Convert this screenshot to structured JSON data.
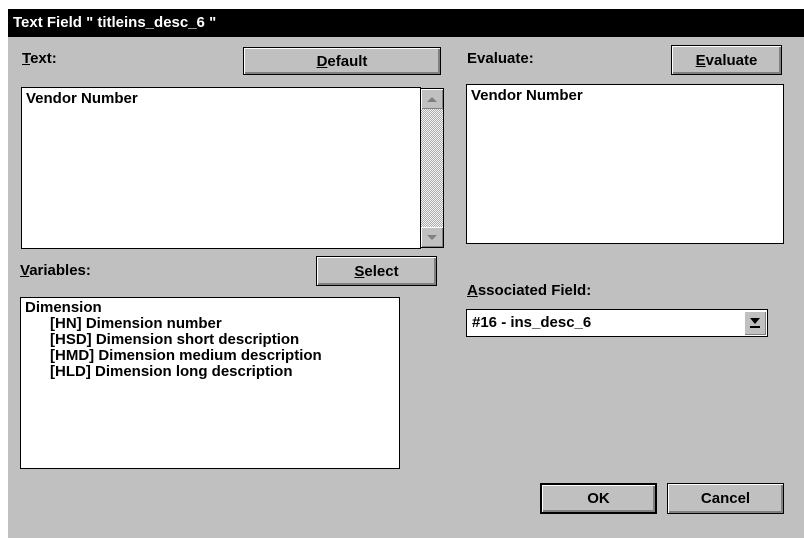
{
  "window": {
    "title": "Text Field \" titleins_desc_6 \""
  },
  "text_section": {
    "label_underlined": "T",
    "label_rest": "ext:",
    "default_btn_u": "D",
    "default_btn_rest": "efault",
    "content": "Vendor Number"
  },
  "evaluate_section": {
    "label": "Evaluate:",
    "btn_u": "E",
    "btn_rest": "valuate",
    "content": "Vendor Number"
  },
  "variables_section": {
    "label_underlined": "V",
    "label_rest": "ariables:",
    "select_btn_u": "S",
    "select_btn_rest": "elect",
    "content": "Dimension\n      [HN] Dimension number\n      [HSD] Dimension short description\n      [HMD] Dimension medium description\n      [HLD] Dimension long description"
  },
  "associated_field": {
    "label_underlined": "A",
    "label_rest": "ssociated Field:",
    "selected": "#16 - ins_desc_6"
  },
  "buttons": {
    "ok": "OK",
    "cancel": "Cancel"
  }
}
